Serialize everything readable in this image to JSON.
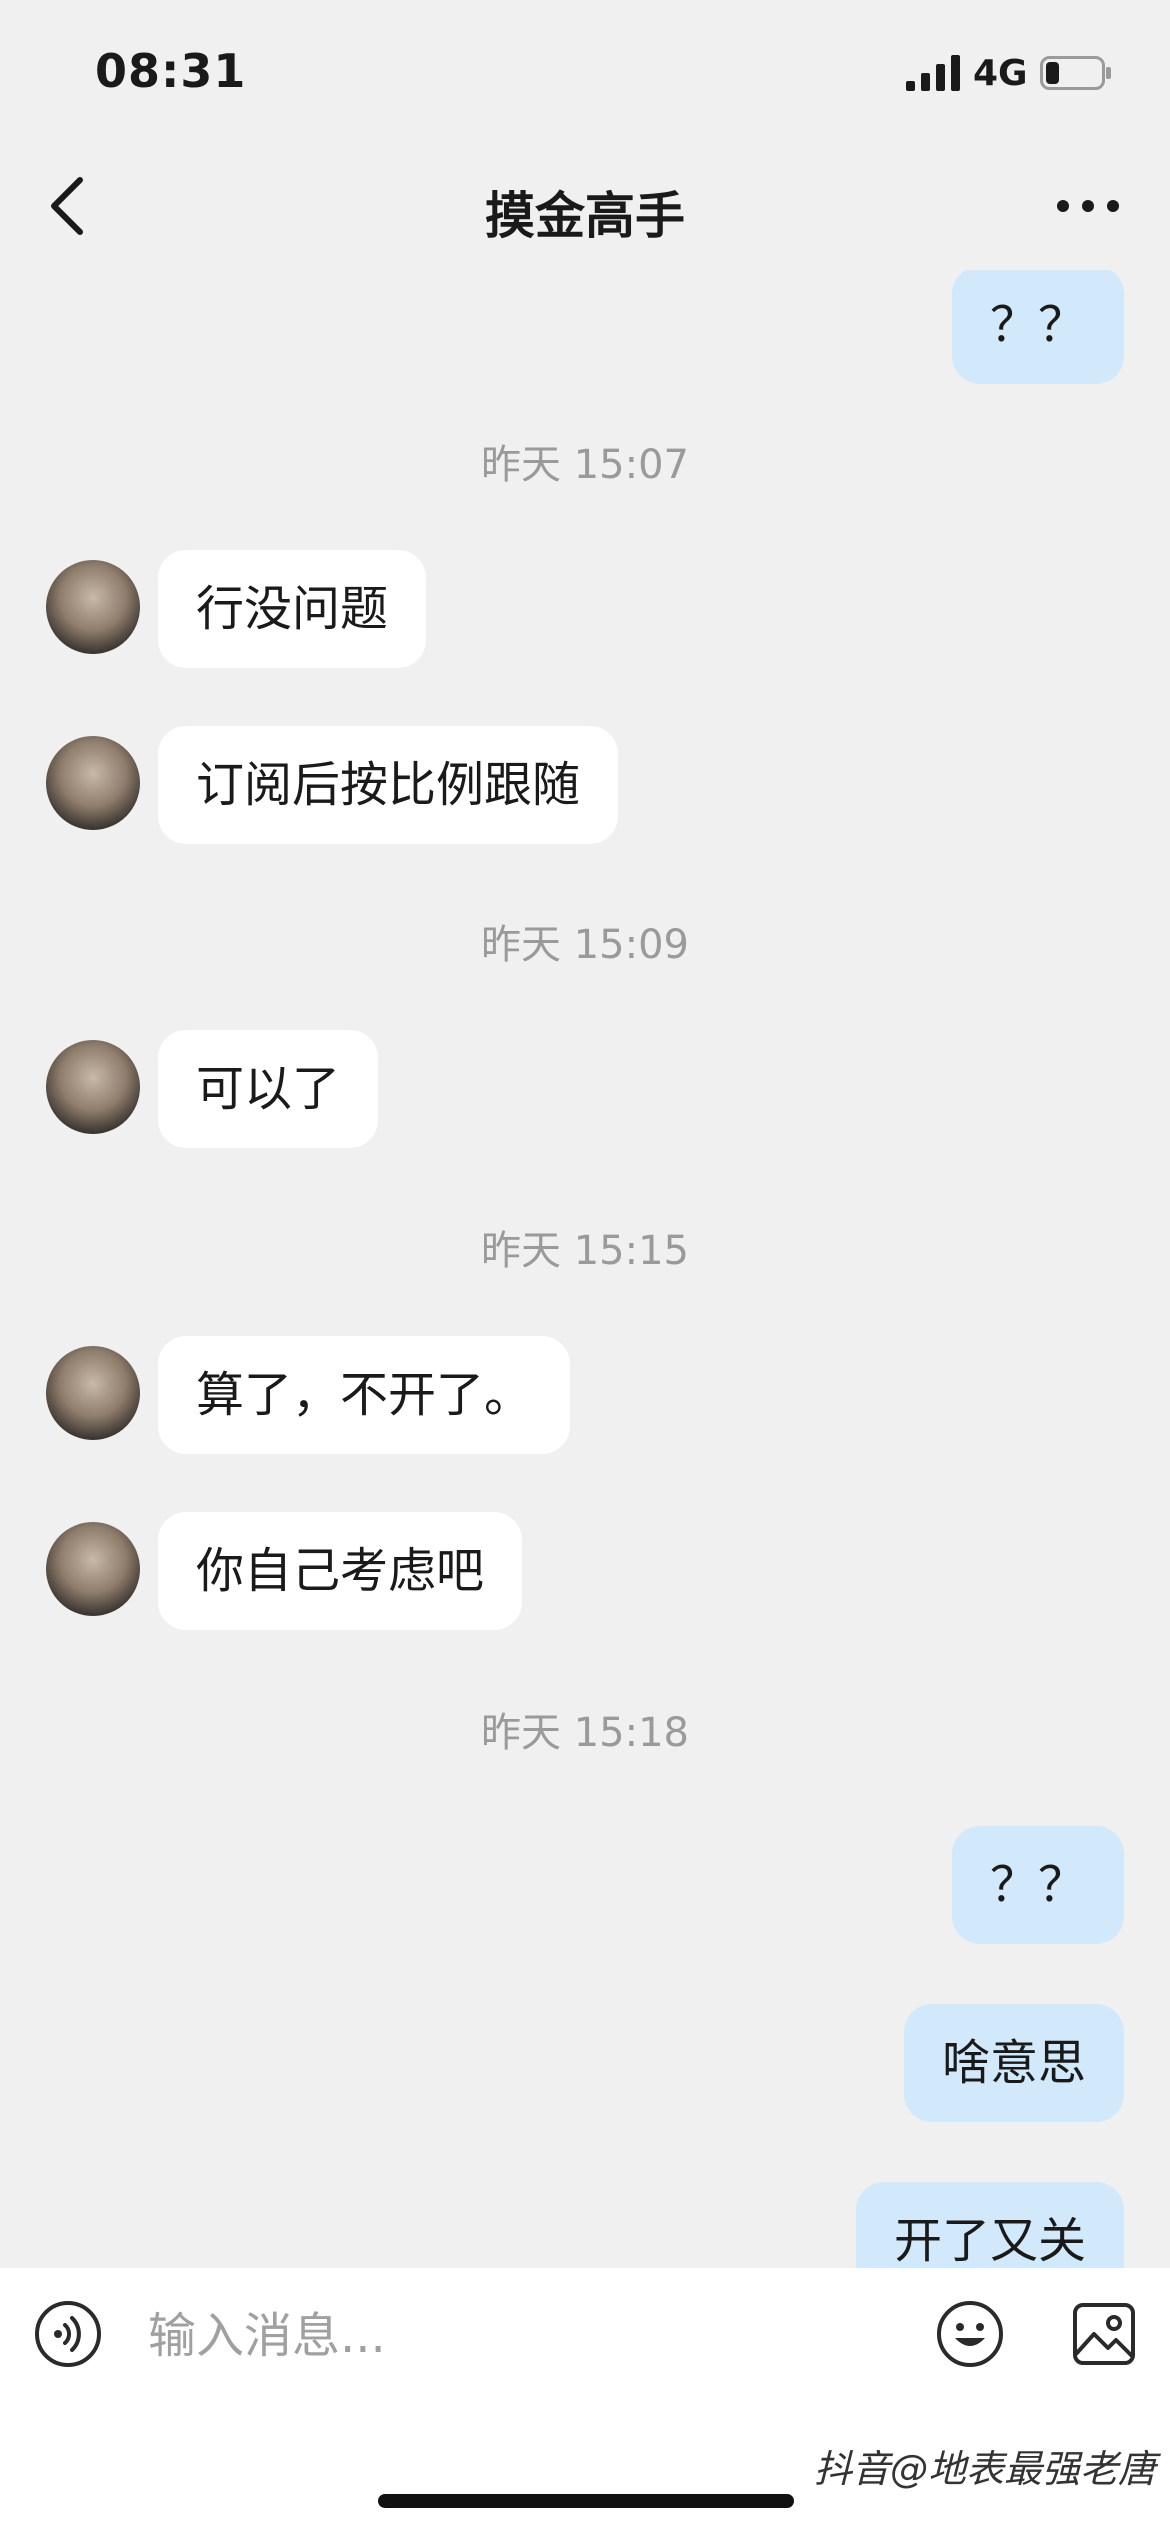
{
  "status_bar": {
    "time": "08:31",
    "network": "4G"
  },
  "header": {
    "title": "摸金高手"
  },
  "messages": [
    {
      "type": "out",
      "text": "？？"
    },
    {
      "type": "time",
      "text": "昨天 15:07"
    },
    {
      "type": "in",
      "text": "行没问题"
    },
    {
      "type": "in",
      "text": "订阅后按比例跟随"
    },
    {
      "type": "time",
      "text": "昨天 15:09"
    },
    {
      "type": "in",
      "text": "可以了"
    },
    {
      "type": "time",
      "text": "昨天 15:15"
    },
    {
      "type": "in",
      "text": "算了，不开了。"
    },
    {
      "type": "in",
      "text": "你自己考虑吧"
    },
    {
      "type": "time",
      "text": "昨天 15:18"
    },
    {
      "type": "out",
      "text": "？？"
    },
    {
      "type": "out",
      "text": "啥意思"
    },
    {
      "type": "out",
      "text": "开了又关"
    }
  ],
  "input_bar": {
    "placeholder": "输入消息..."
  },
  "watermark": "抖音@地表最强老唐",
  "colors": {
    "background": "#f0f0f0",
    "incoming_bubble": "#ffffff",
    "outgoing_bubble": "#d2e8fb",
    "timestamp_text": "#9a9a9a"
  }
}
